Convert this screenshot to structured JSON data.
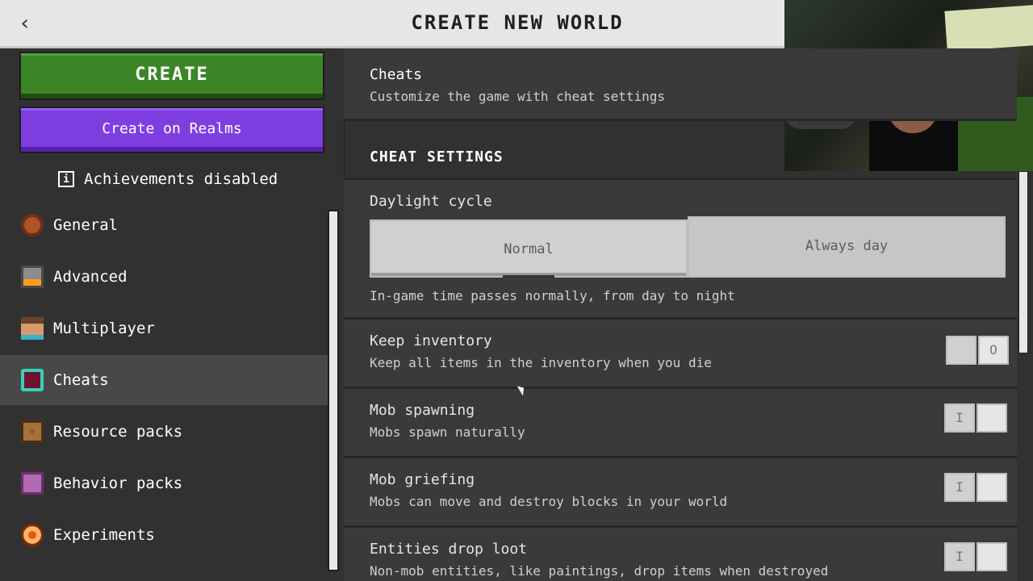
{
  "header": {
    "title": "CREATE NEW WORLD",
    "back_icon": "chevron-left-icon"
  },
  "sidebar": {
    "create_label": "CREATE",
    "realms_label": "Create on Realms",
    "achievements_text": "Achievements disabled",
    "items": [
      {
        "label": "General",
        "icon": "gear-icon",
        "color": "#b0532d"
      },
      {
        "label": "Advanced",
        "icon": "furnace-icon",
        "color": "#cfcfcf"
      },
      {
        "label": "Multiplayer",
        "icon": "player-face-icon",
        "color": "#6fbcd1"
      },
      {
        "label": "Cheats",
        "icon": "cheats-icon",
        "color": "#8b1b3a",
        "selected": true
      },
      {
        "label": "Resource packs",
        "icon": "chest-icon",
        "color": "#8e5f2b"
      },
      {
        "label": "Behavior packs",
        "icon": "behavior-icon",
        "color": "#b06ab0"
      },
      {
        "label": "Experiments",
        "icon": "experiments-icon",
        "color": "#e05a14"
      }
    ]
  },
  "content": {
    "cheats_row": {
      "title": "Cheats",
      "subtitle": "Customize the game with cheat settings"
    },
    "section_title": "CHEAT SETTINGS",
    "daylight": {
      "title": "Daylight cycle",
      "options": [
        "Normal",
        "Always day"
      ],
      "selected": "Normal",
      "description": "In-game time passes normally, from day to night"
    },
    "toggles": [
      {
        "title": "Keep inventory",
        "subtitle": "Keep all items in the inventory when you die",
        "state": "off",
        "glyph": "O"
      },
      {
        "title": "Mob spawning",
        "subtitle": "Mobs spawn naturally",
        "state": "on",
        "glyph": "I"
      },
      {
        "title": "Mob griefing",
        "subtitle": "Mobs can move and destroy blocks in your world",
        "state": "on",
        "glyph": "I"
      },
      {
        "title": "Entities drop loot",
        "subtitle": "Non-mob entities, like paintings, drop items when destroyed",
        "state": "on",
        "glyph": "I"
      }
    ]
  }
}
